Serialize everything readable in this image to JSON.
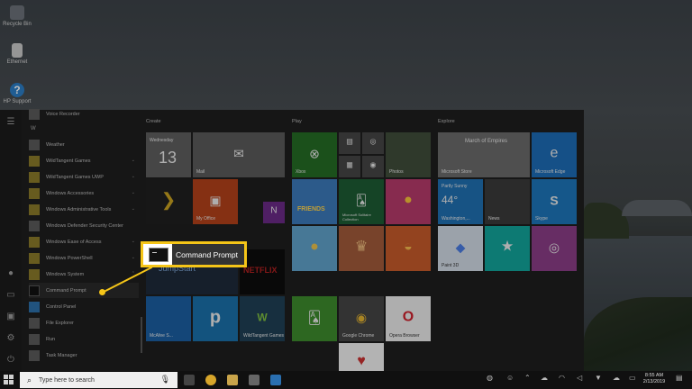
{
  "desktop": {
    "icons": [
      {
        "label": "Recycle Bin",
        "icon": "recycle-bin-icon"
      },
      {
        "label": "Ethernet",
        "icon": "file-icon"
      },
      {
        "label": "HP Support",
        "icon": "help-icon"
      }
    ]
  },
  "start_menu": {
    "apps": [
      {
        "label": "Voice Recorder",
        "icon": "app-icon",
        "style": "gray"
      },
      {
        "label": "W",
        "type": "letter"
      },
      {
        "label": "Weather",
        "icon": "app-icon",
        "style": "gray"
      },
      {
        "label": "WildTangent Games",
        "icon": "folder-icon",
        "expand": true
      },
      {
        "label": "WildTangent Games UWP",
        "icon": "folder-icon",
        "expand": true
      },
      {
        "label": "Windows Accessories",
        "icon": "folder-icon",
        "expand": true
      },
      {
        "label": "Windows Administrative Tools",
        "icon": "folder-icon",
        "expand": true
      },
      {
        "label": "Windows Defender Security Center",
        "icon": "app-icon",
        "style": "gray"
      },
      {
        "label": "Windows Ease of Access",
        "icon": "folder-icon",
        "expand": true
      },
      {
        "label": "Windows PowerShell",
        "icon": "folder-icon",
        "expand": true
      },
      {
        "label": "Windows System",
        "icon": "folder-icon",
        "expand": true
      },
      {
        "label": "Command Prompt",
        "icon": "command-prompt-icon",
        "style": "dark",
        "selected": true
      },
      {
        "label": "Control Panel",
        "icon": "app-icon",
        "style": "blue"
      },
      {
        "label": "File Explorer",
        "icon": "app-icon",
        "style": "gray"
      },
      {
        "label": "Run",
        "icon": "app-icon",
        "style": "gray"
      },
      {
        "label": "Task Manager",
        "icon": "app-icon",
        "style": "gray"
      }
    ],
    "groups": {
      "create": "Create",
      "play": "Play",
      "explore": "Explore"
    },
    "tiles": {
      "calendar_day": "Wednesday",
      "calendar_date": "13",
      "mail": "Mail",
      "myoffice": "My Office",
      "xbox": "Xbox",
      "photos": "Photos",
      "friends": "FRIENDS",
      "solitaire": "Microsoft Solitaire Collection",
      "store_news": "March of Empires",
      "store": "Microsoft Store",
      "edge": "Microsoft Edge",
      "weather_cond": "Partly Sunny",
      "weather_temp": "44°",
      "weather_city": "Washington,...",
      "news": "News",
      "skype": "Skype",
      "paint3d": "Paint 3D",
      "jumpstart": "JumpStart",
      "netflix": "NETFLIX",
      "mcafee": "McAfee S...",
      "p_tile": "p",
      "wildtangent": "WildTangent Games",
      "chrome": "Google Chrome",
      "opera": "Opera Browser"
    }
  },
  "callout": {
    "label": "Command Prompt"
  },
  "taskbar": {
    "search_placeholder": "Type here to search",
    "time": "8:55 AM",
    "date": "2/13/2019"
  }
}
